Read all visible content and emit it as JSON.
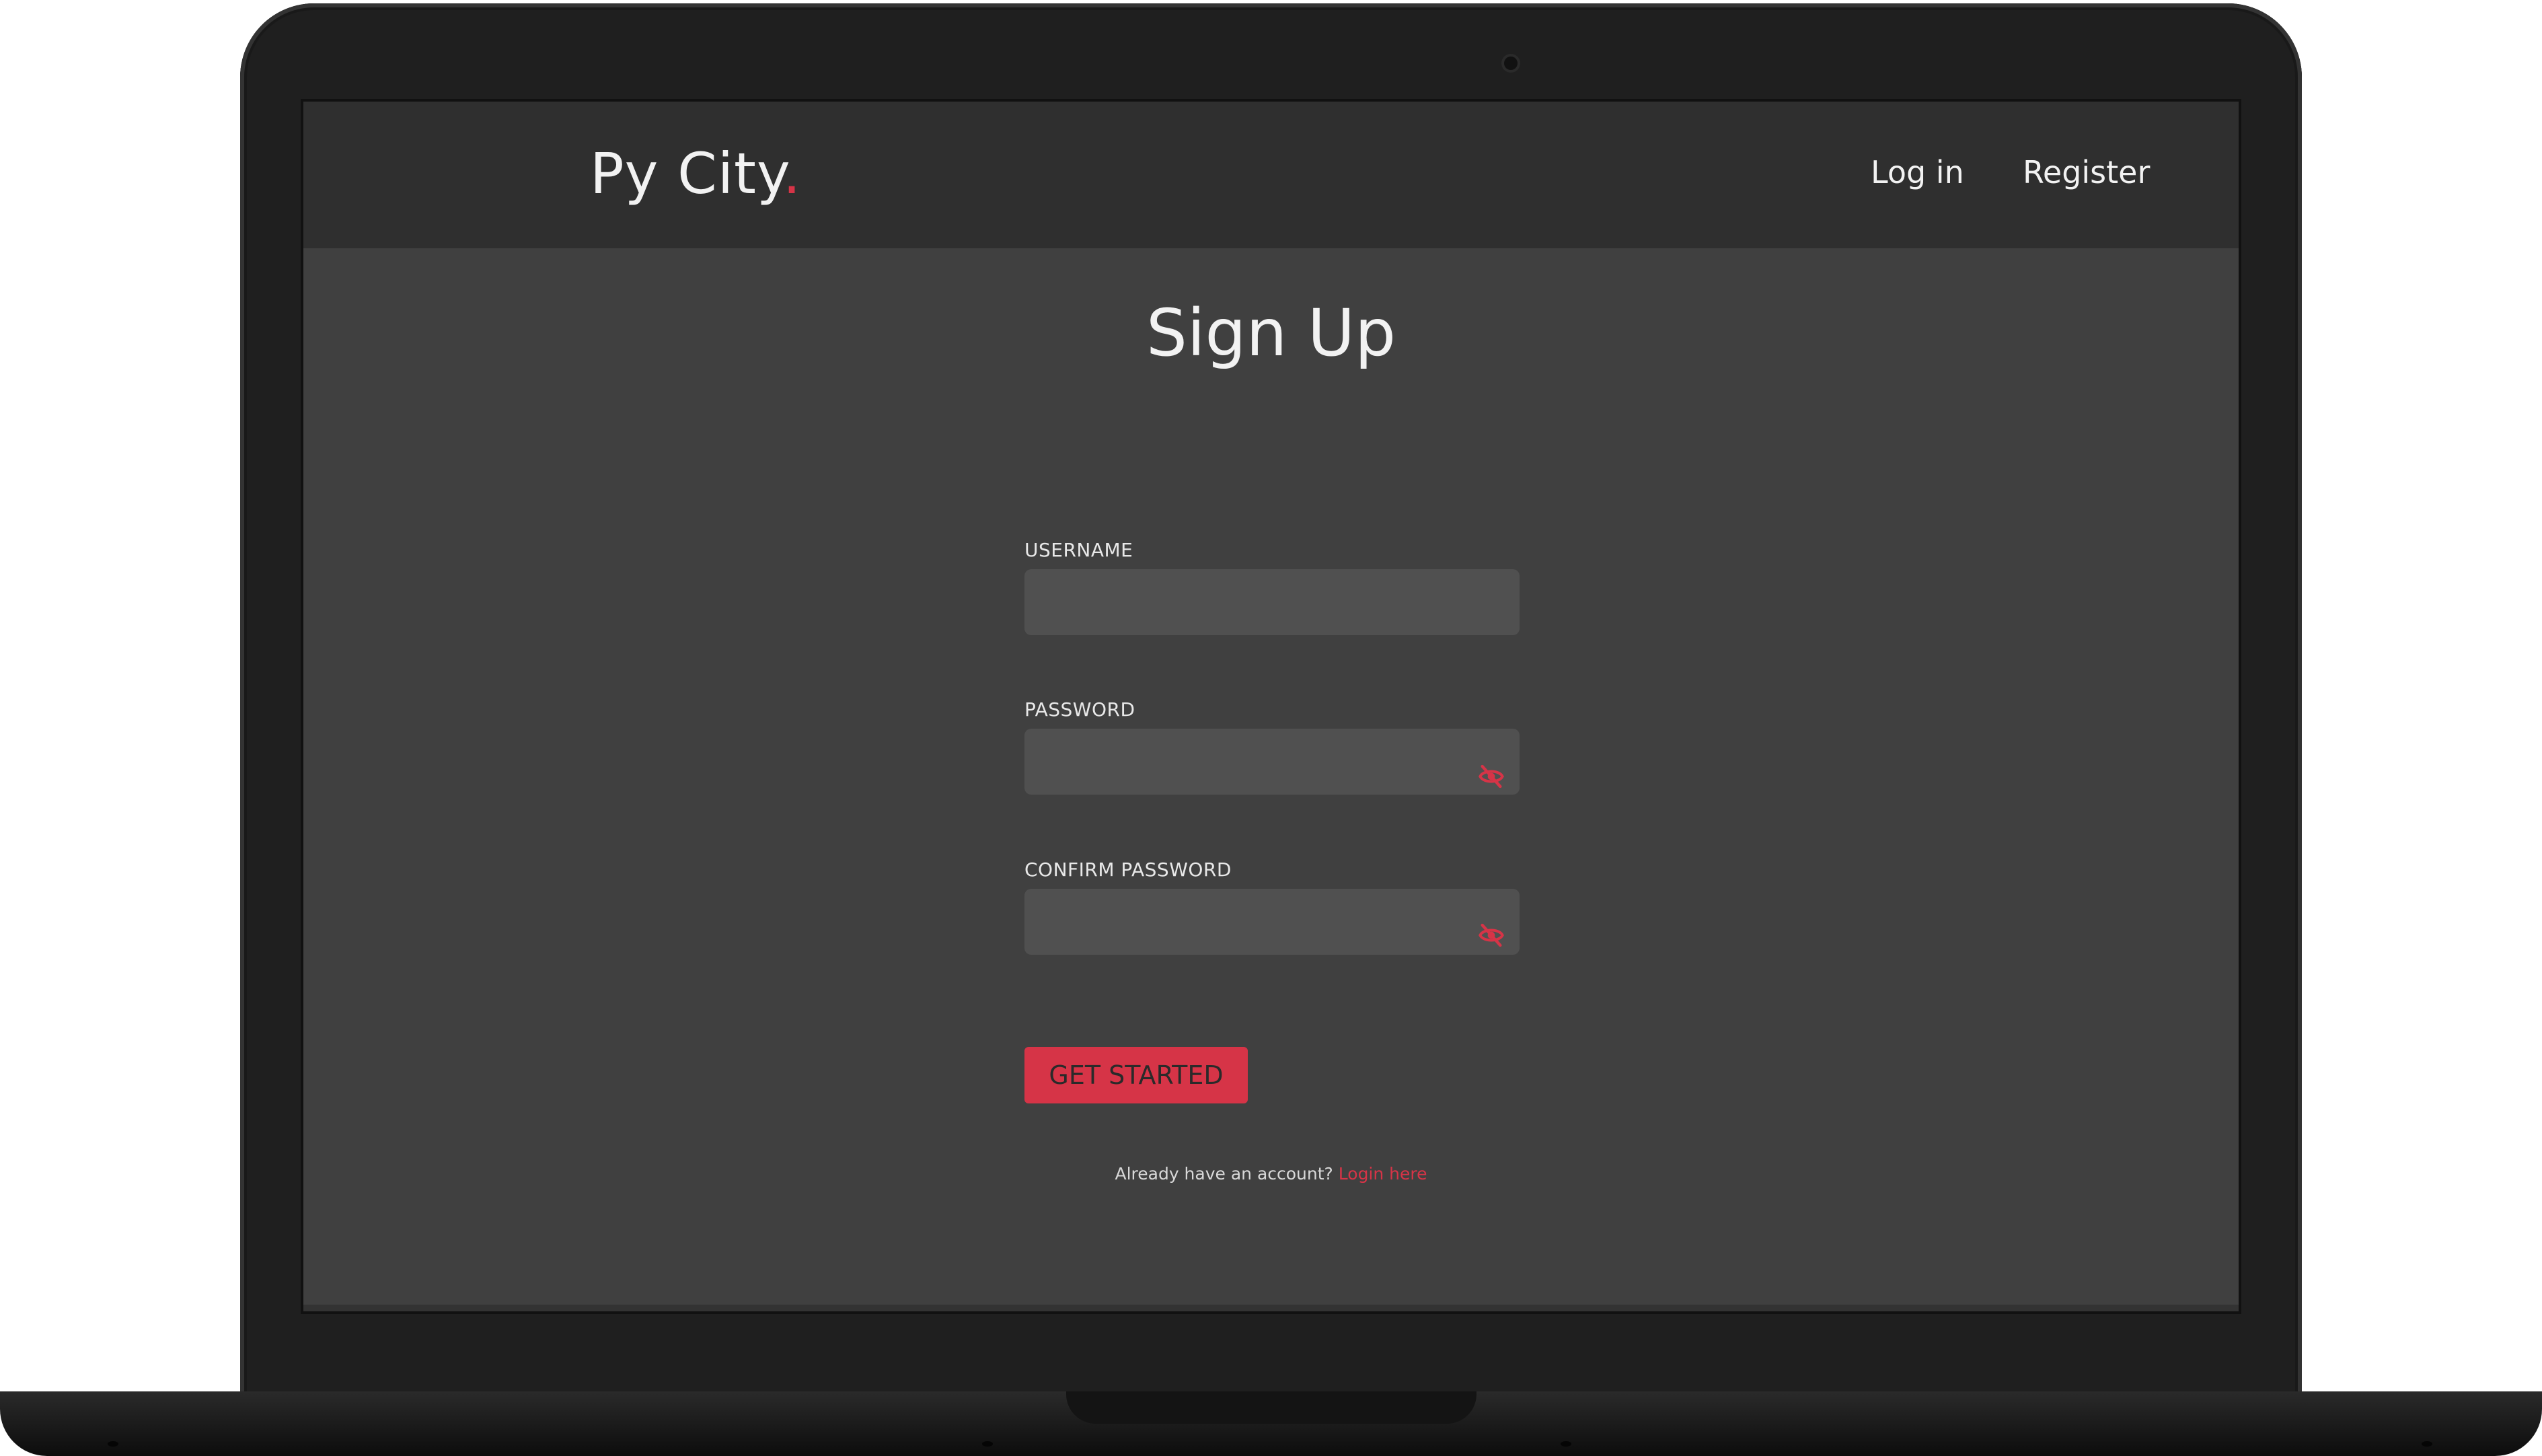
{
  "nav": {
    "logo_text": "Py City",
    "logo_dot": ".",
    "links": [
      {
        "label": "Log in"
      },
      {
        "label": "Register"
      }
    ]
  },
  "form": {
    "title": "Sign Up",
    "fields": [
      {
        "label": "USERNAME",
        "value": "",
        "placeholder": ""
      },
      {
        "label": "PASSWORD",
        "value": "",
        "placeholder": ""
      },
      {
        "label": "CONFIRM PASSWORD",
        "value": "",
        "placeholder": ""
      }
    ],
    "submit_label": "GET STARTED",
    "account_prompt": "Already have an account?",
    "login_link": "Login here"
  },
  "colors": {
    "accent": "#d63447",
    "navbar_bg": "#2f2f2f",
    "page_bg": "#404040",
    "input_bg": "#505050"
  },
  "icons": {
    "password_toggle": "eye-off-icon",
    "confirm_password_toggle": "eye-off-icon"
  }
}
